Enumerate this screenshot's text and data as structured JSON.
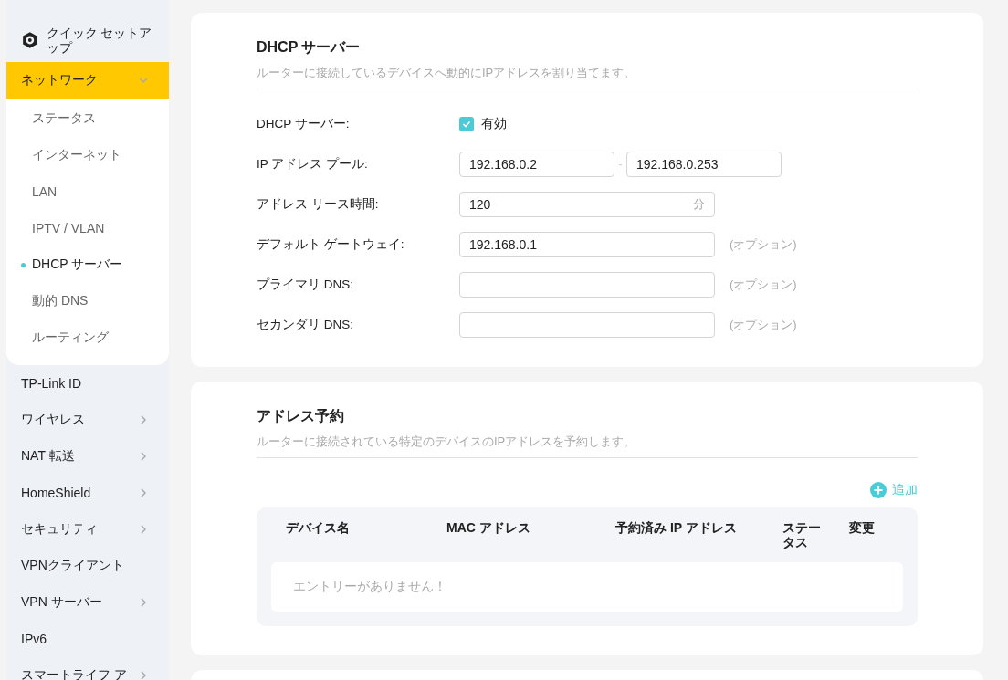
{
  "sidebar": {
    "quick_setup": {
      "label": "クイック セットアップ"
    },
    "items": [
      {
        "label": "ネットワーク",
        "has_submenu": true,
        "expanded": true,
        "children": [
          {
            "label": "ステータス",
            "selected": false
          },
          {
            "label": "インターネット",
            "selected": false
          },
          {
            "label": "LAN",
            "selected": false
          },
          {
            "label": "IPTV / VLAN",
            "selected": false
          },
          {
            "label": "DHCP サーバー",
            "selected": true
          },
          {
            "label": "動的 DNS",
            "selected": false
          },
          {
            "label": "ルーティング",
            "selected": false
          }
        ]
      },
      {
        "label": "TP-Link ID",
        "has_submenu": false,
        "expanded": false
      },
      {
        "label": "ワイヤレス",
        "has_submenu": true,
        "expanded": false
      },
      {
        "label": "NAT 転送",
        "has_submenu": true,
        "expanded": false
      },
      {
        "label": "HomeShield",
        "has_submenu": true,
        "expanded": false
      },
      {
        "label": "セキュリティ",
        "has_submenu": true,
        "expanded": false
      },
      {
        "label": "VPNクライアント",
        "has_submenu": false,
        "expanded": false
      },
      {
        "label": "VPN サーバー",
        "has_submenu": true,
        "expanded": false
      },
      {
        "label": "IPv6",
        "has_submenu": false,
        "expanded": false
      },
      {
        "label": "スマートライフ ア",
        "has_submenu": true,
        "expanded": false
      }
    ]
  },
  "dhcp_server": {
    "title": "DHCP サーバー",
    "description": "ルーターに接続しているデバイスへ動的にIPアドレスを割り当てます。",
    "fields": [
      {
        "kind": "checkbox",
        "label": "DHCP サーバー:",
        "option_label": "有効",
        "checked": true
      },
      {
        "kind": "range",
        "label": "IP アドレス プール:",
        "values": [
          "192.168.0.2",
          "192.168.0.253"
        ],
        "separator": "-"
      },
      {
        "kind": "text",
        "label": "アドレス リース時間:",
        "value": "120",
        "unit": "分"
      },
      {
        "kind": "text",
        "label": "デフォルト ゲートウェイ:",
        "value": "192.168.0.1",
        "note": "(オプション)"
      },
      {
        "kind": "text",
        "label": "プライマリ DNS:",
        "note": "(オプション)"
      },
      {
        "kind": "text",
        "label": "セカンダリ DNS:",
        "note": "(オプション)"
      }
    ]
  },
  "address_reservation": {
    "title": "アドレス予約",
    "description": "ルーターに接続されている特定のデバイスのIPアドレスを予約します。",
    "add_button": "追加",
    "table": {
      "columns": [
        "デバイス名",
        "MAC アドレス",
        "予約済み IP アドレス",
        "ステータス",
        "変更"
      ],
      "empty_message": "エントリーがありません！"
    }
  }
}
